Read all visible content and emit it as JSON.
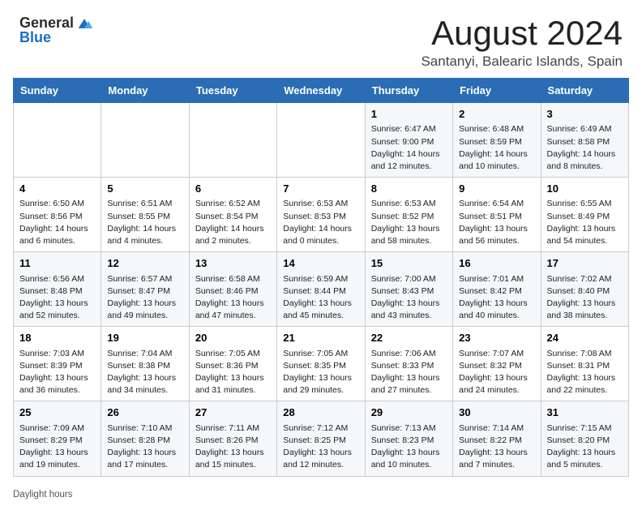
{
  "header": {
    "logo_line1": "General",
    "logo_line2": "Blue",
    "main_title": "August 2024",
    "subtitle": "Santanyi, Balearic Islands, Spain"
  },
  "calendar": {
    "weekdays": [
      "Sunday",
      "Monday",
      "Tuesday",
      "Wednesday",
      "Thursday",
      "Friday",
      "Saturday"
    ],
    "weeks": [
      [
        {
          "day": "",
          "info": ""
        },
        {
          "day": "",
          "info": ""
        },
        {
          "day": "",
          "info": ""
        },
        {
          "day": "",
          "info": ""
        },
        {
          "day": "1",
          "info": "Sunrise: 6:47 AM\nSunset: 9:00 PM\nDaylight: 14 hours and 12 minutes."
        },
        {
          "day": "2",
          "info": "Sunrise: 6:48 AM\nSunset: 8:59 PM\nDaylight: 14 hours and 10 minutes."
        },
        {
          "day": "3",
          "info": "Sunrise: 6:49 AM\nSunset: 8:58 PM\nDaylight: 14 hours and 8 minutes."
        }
      ],
      [
        {
          "day": "4",
          "info": "Sunrise: 6:50 AM\nSunset: 8:56 PM\nDaylight: 14 hours and 6 minutes."
        },
        {
          "day": "5",
          "info": "Sunrise: 6:51 AM\nSunset: 8:55 PM\nDaylight: 14 hours and 4 minutes."
        },
        {
          "day": "6",
          "info": "Sunrise: 6:52 AM\nSunset: 8:54 PM\nDaylight: 14 hours and 2 minutes."
        },
        {
          "day": "7",
          "info": "Sunrise: 6:53 AM\nSunset: 8:53 PM\nDaylight: 14 hours and 0 minutes."
        },
        {
          "day": "8",
          "info": "Sunrise: 6:53 AM\nSunset: 8:52 PM\nDaylight: 13 hours and 58 minutes."
        },
        {
          "day": "9",
          "info": "Sunrise: 6:54 AM\nSunset: 8:51 PM\nDaylight: 13 hours and 56 minutes."
        },
        {
          "day": "10",
          "info": "Sunrise: 6:55 AM\nSunset: 8:49 PM\nDaylight: 13 hours and 54 minutes."
        }
      ],
      [
        {
          "day": "11",
          "info": "Sunrise: 6:56 AM\nSunset: 8:48 PM\nDaylight: 13 hours and 52 minutes."
        },
        {
          "day": "12",
          "info": "Sunrise: 6:57 AM\nSunset: 8:47 PM\nDaylight: 13 hours and 49 minutes."
        },
        {
          "day": "13",
          "info": "Sunrise: 6:58 AM\nSunset: 8:46 PM\nDaylight: 13 hours and 47 minutes."
        },
        {
          "day": "14",
          "info": "Sunrise: 6:59 AM\nSunset: 8:44 PM\nDaylight: 13 hours and 45 minutes."
        },
        {
          "day": "15",
          "info": "Sunrise: 7:00 AM\nSunset: 8:43 PM\nDaylight: 13 hours and 43 minutes."
        },
        {
          "day": "16",
          "info": "Sunrise: 7:01 AM\nSunset: 8:42 PM\nDaylight: 13 hours and 40 minutes."
        },
        {
          "day": "17",
          "info": "Sunrise: 7:02 AM\nSunset: 8:40 PM\nDaylight: 13 hours and 38 minutes."
        }
      ],
      [
        {
          "day": "18",
          "info": "Sunrise: 7:03 AM\nSunset: 8:39 PM\nDaylight: 13 hours and 36 minutes."
        },
        {
          "day": "19",
          "info": "Sunrise: 7:04 AM\nSunset: 8:38 PM\nDaylight: 13 hours and 34 minutes."
        },
        {
          "day": "20",
          "info": "Sunrise: 7:05 AM\nSunset: 8:36 PM\nDaylight: 13 hours and 31 minutes."
        },
        {
          "day": "21",
          "info": "Sunrise: 7:05 AM\nSunset: 8:35 PM\nDaylight: 13 hours and 29 minutes."
        },
        {
          "day": "22",
          "info": "Sunrise: 7:06 AM\nSunset: 8:33 PM\nDaylight: 13 hours and 27 minutes."
        },
        {
          "day": "23",
          "info": "Sunrise: 7:07 AM\nSunset: 8:32 PM\nDaylight: 13 hours and 24 minutes."
        },
        {
          "day": "24",
          "info": "Sunrise: 7:08 AM\nSunset: 8:31 PM\nDaylight: 13 hours and 22 minutes."
        }
      ],
      [
        {
          "day": "25",
          "info": "Sunrise: 7:09 AM\nSunset: 8:29 PM\nDaylight: 13 hours and 19 minutes."
        },
        {
          "day": "26",
          "info": "Sunrise: 7:10 AM\nSunset: 8:28 PM\nDaylight: 13 hours and 17 minutes."
        },
        {
          "day": "27",
          "info": "Sunrise: 7:11 AM\nSunset: 8:26 PM\nDaylight: 13 hours and 15 minutes."
        },
        {
          "day": "28",
          "info": "Sunrise: 7:12 AM\nSunset: 8:25 PM\nDaylight: 13 hours and 12 minutes."
        },
        {
          "day": "29",
          "info": "Sunrise: 7:13 AM\nSunset: 8:23 PM\nDaylight: 13 hours and 10 minutes."
        },
        {
          "day": "30",
          "info": "Sunrise: 7:14 AM\nSunset: 8:22 PM\nDaylight: 13 hours and 7 minutes."
        },
        {
          "day": "31",
          "info": "Sunrise: 7:15 AM\nSunset: 8:20 PM\nDaylight: 13 hours and 5 minutes."
        }
      ]
    ]
  },
  "footer": {
    "text": "Daylight hours"
  }
}
